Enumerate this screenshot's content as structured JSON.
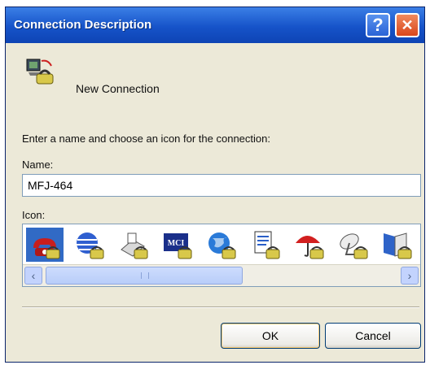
{
  "window": {
    "title": "Connection Description",
    "help_symbol": "?",
    "close_symbol": "✕"
  },
  "header": {
    "connection_name": "New Connection",
    "icon": "phone-computer-icon"
  },
  "instruction": "Enter a name and choose an icon for the connection:",
  "name_field": {
    "label": "Name:",
    "value": "MFJ-464"
  },
  "icon_picker": {
    "label": "Icon:",
    "icons": [
      {
        "name": "red-phone-icon",
        "selected": true
      },
      {
        "name": "blue-globe-icon",
        "selected": false
      },
      {
        "name": "fax-machine-icon",
        "selected": false
      },
      {
        "name": "mci-icon",
        "selected": false,
        "text": "MCI"
      },
      {
        "name": "world-globe-icon",
        "selected": false
      },
      {
        "name": "document-icon",
        "selected": false
      },
      {
        "name": "umbrella-icon",
        "selected": false
      },
      {
        "name": "satellite-dish-icon",
        "selected": false
      },
      {
        "name": "book-icon",
        "selected": false
      }
    ],
    "scroll_left": "‹",
    "scroll_right": "›"
  },
  "buttons": {
    "ok": "OK",
    "cancel": "Cancel"
  },
  "colors": {
    "titlebar": "#1653c9",
    "selection": "#316ac5",
    "window_bg": "#ece9d8"
  }
}
